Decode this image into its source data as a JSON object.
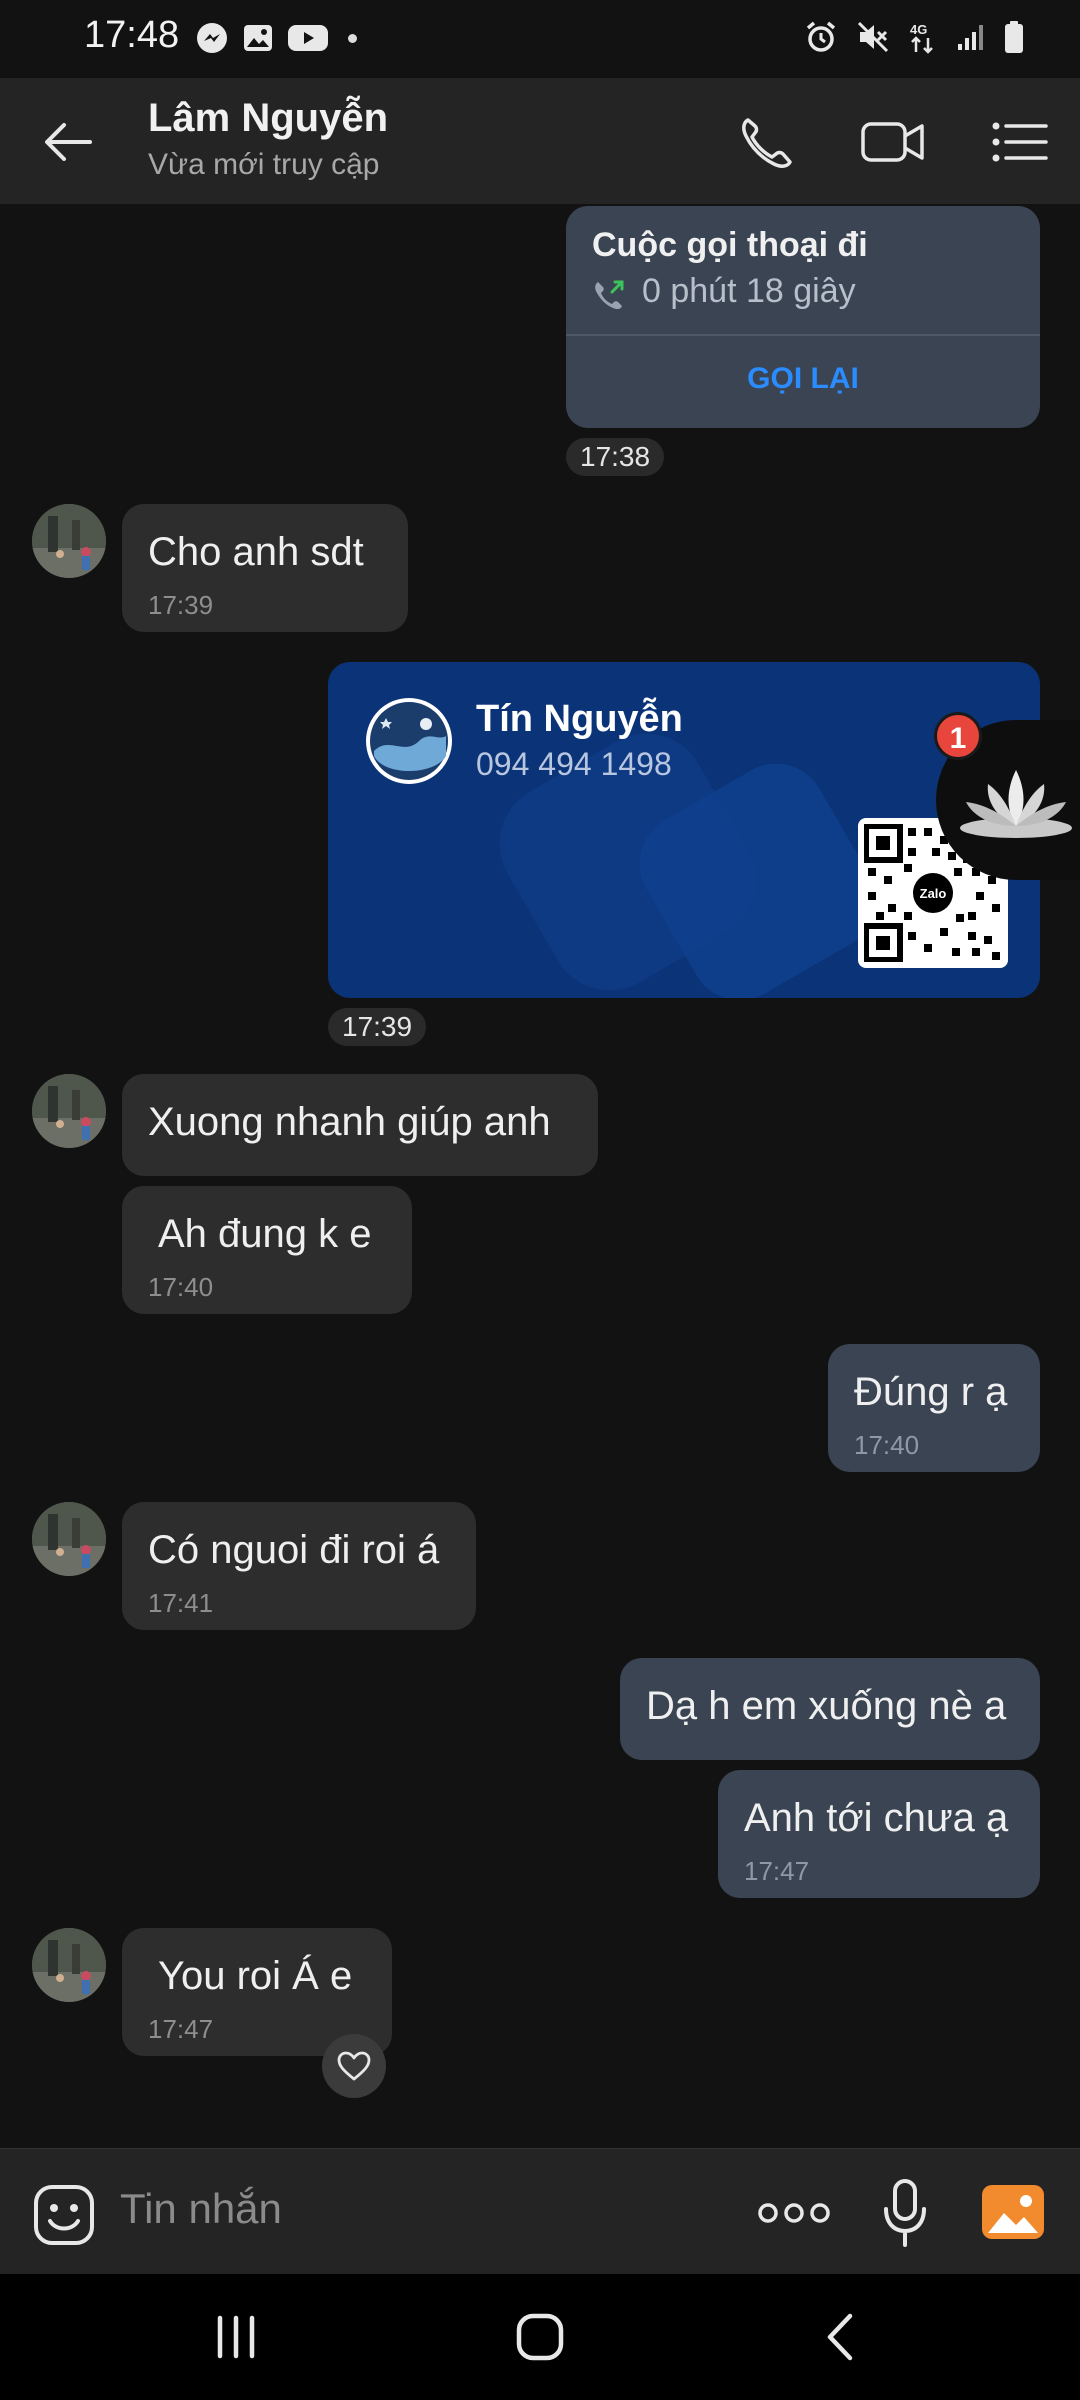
{
  "status_bar": {
    "time": "17:48",
    "network": "4G"
  },
  "header": {
    "contact_name": "Lâm Nguyễn",
    "contact_status": "Vừa mới truy cập"
  },
  "call_card": {
    "title": "Cuộc gọi thoại đi",
    "duration": "0 phút 18 giây",
    "action": "GỌI LẠI",
    "time": "17:38"
  },
  "messages": [
    {
      "text": "Cho anh sdt",
      "time": "17:39"
    },
    {
      "text": "Xuong nhanh giúp anh"
    },
    {
      "text": "Ah đung k e",
      "time": "17:40"
    },
    {
      "text": "Đúng r ạ",
      "time": "17:40"
    },
    {
      "text": "Có nguoi đi roi á",
      "time": "17:41"
    },
    {
      "text": "Dạ h em xuống nè a"
    },
    {
      "text": "Anh tới chưa ạ",
      "time": "17:47"
    },
    {
      "text": "You roi Á e",
      "time": "17:47"
    }
  ],
  "contact_card": {
    "name": "Tín Nguyễn",
    "phone": "094 494 1498",
    "time": "17:39",
    "qr_label": "Zalo"
  },
  "floating_badge": "1",
  "input": {
    "placeholder": "Tin nhắn"
  },
  "colors": {
    "background": "#121212",
    "incoming_bubble": "#2d2d2d",
    "outgoing_bubble": "#3a4453",
    "accent": "#2a8cff",
    "card": "#0b3478"
  }
}
